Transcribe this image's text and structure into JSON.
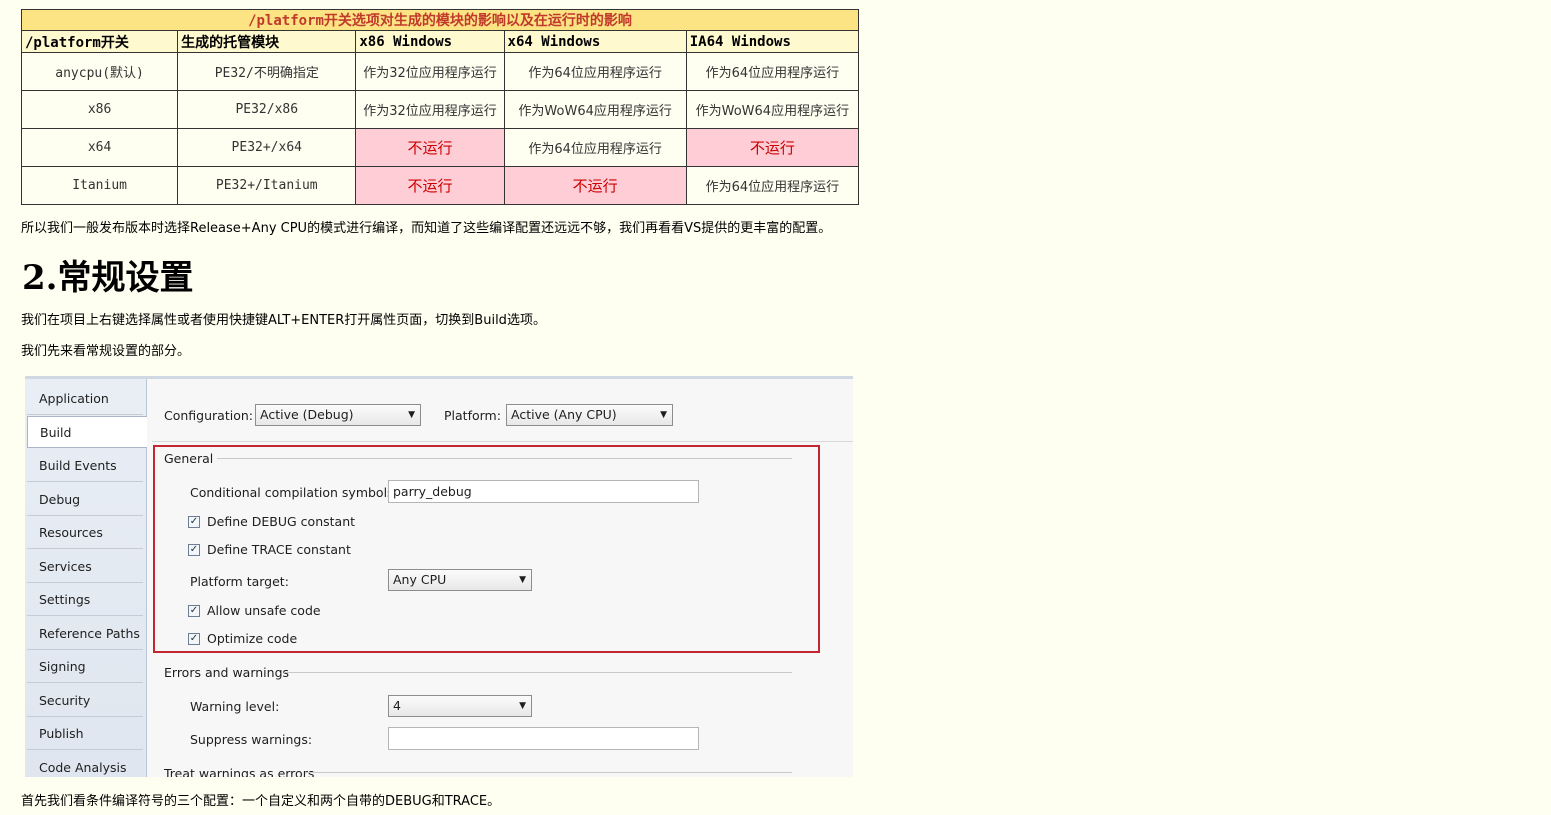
{
  "table": {
    "caption": "/platform开关选项对生成的模块的影响以及在运行时的影响",
    "headers": [
      "/platform开关",
      "生成的托管模块",
      "x86 Windows",
      "x64 Windows",
      "IA64 Windows"
    ],
    "rows": [
      [
        "anycpu(默认)",
        "PE32/不明确指定",
        "作为32位应用程序运行",
        "作为64位应用程序运行",
        "作为64位应用程序运行"
      ],
      [
        "x86",
        "PE32/x86",
        "作为32位应用程序运行",
        "作为WoW64应用程序运行",
        "作为WoW64应用程序运行"
      ],
      [
        "x64",
        "PE32+/x64",
        "不运行",
        "作为64位应用程序运行",
        "不运行"
      ],
      [
        "Itanium",
        "PE32+/Itanium",
        "不运行",
        "不运行",
        "作为64位应用程序运行"
      ]
    ],
    "highlight_color": "#ffcdd6"
  },
  "para1": "所以我们一般发布版本时选择Release+Any CPU的模式进行编译，而知道了这些编译配置还远远不够，我们再看看VS提供的更丰富的配置。",
  "heading": "2.常规设置",
  "para2": "我们在项目上右键选择属性或者使用快捷键ALT+ENTER打开属性页面，切换到Build选项。",
  "para3": "我们先来看常规设置的部分。",
  "para4": "首先我们看条件编译符号的三个配置：一个自定义和两个自带的DEBUG和TRACE。",
  "vs": {
    "tabs": [
      "Application",
      "Build",
      "Build Events",
      "Debug",
      "Resources",
      "Services",
      "Settings",
      "Reference Paths",
      "Signing",
      "Security",
      "Publish",
      "Code Analysis"
    ],
    "active_tab": "Build",
    "configuration_label": "Configuration:",
    "configuration_value": "Active (Debug)",
    "platform_label": "Platform:",
    "platform_value": "Active (Any CPU)",
    "general_label": "General",
    "symbols_label": "Conditional compilation symbols:",
    "symbols_value": "parry_debug",
    "define_debug": "Define DEBUG constant",
    "define_trace": "Define TRACE constant",
    "platform_target_label": "Platform target:",
    "platform_target_value": "Any CPU",
    "allow_unsafe": "Allow unsafe code",
    "optimize": "Optimize code",
    "errors_label": "Errors and warnings",
    "warning_level_label": "Warning level:",
    "warning_level_value": "4",
    "suppress_label": "Suppress warnings:",
    "suppress_value": "",
    "treat_label": "Treat warnings as errors",
    "checked_mark": "✓",
    "highlight_box_color": "#c3262f"
  }
}
